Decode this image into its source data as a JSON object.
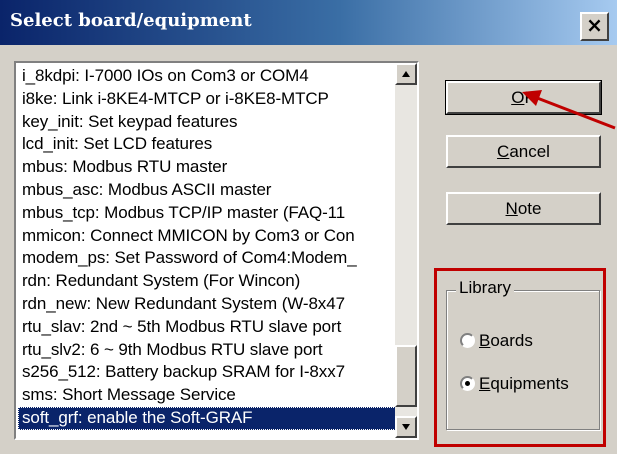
{
  "window": {
    "title": "Select board/equipment",
    "close_glyph": "×"
  },
  "list": {
    "items": [
      "i_8kdpi: I-7000 IOs on Com3 or COM4",
      "i8ke: Link i-8KE4-MTCP or i-8KE8-MTCP",
      "key_init: Set keypad features",
      "lcd_init: Set LCD features",
      "mbus: Modbus RTU master",
      "mbus_asc: Modbus ASCII master",
      "mbus_tcp: Modbus TCP/IP master (FAQ-11",
      "mmicon: Connect MMICON by Com3 or Con",
      "modem_ps: Set Password of Com4:Modem_",
      "rdn: Redundant System (For Wincon)",
      "rdn_new: New Redundant System (W-8x47",
      "rtu_slav: 2nd ~ 5th Modbus RTU slave port",
      "rtu_slv2: 6 ~ 9th Modbus RTU slave port",
      "s256_512: Battery backup SRAM for I-8xx7",
      "sms: Short Message Service",
      "soft_grf: enable the Soft-GRAF"
    ],
    "selected_index": 15
  },
  "buttons": {
    "ok": {
      "mnemonic": "O",
      "rest": "K"
    },
    "cancel": {
      "mnemonic": "C",
      "rest": "ancel"
    },
    "note": {
      "mnemonic": "N",
      "rest": "ote"
    }
  },
  "library": {
    "title": "Library",
    "options": [
      {
        "mnemonic": "B",
        "rest": "oards",
        "checked": false
      },
      {
        "mnemonic": "E",
        "rest": "quipments",
        "checked": true
      }
    ]
  },
  "colors": {
    "highlight": "#c00000",
    "titlebar": "#0a246a",
    "selection": "#0a246a"
  },
  "icons": {
    "scroll_up": "triangle-up-icon",
    "scroll_down": "triangle-down-icon",
    "arrow": "red-arrow-icon"
  }
}
